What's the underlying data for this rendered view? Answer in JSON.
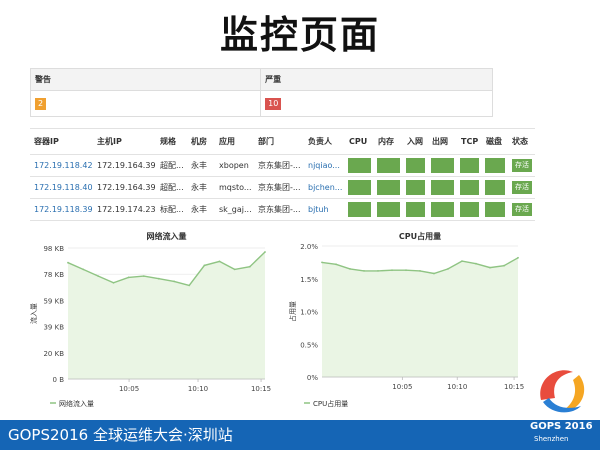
{
  "page": {
    "title": "监控页面"
  },
  "alerts": {
    "headers": [
      "警告",
      "严重"
    ],
    "warning_count": "2",
    "critical_count": "10",
    "warning_color": "#f0a030",
    "critical_color": "#d9534f"
  },
  "containers": {
    "headers": [
      "容器IP",
      "主机IP",
      "规格",
      "机房",
      "应用",
      "部门",
      "负责人",
      "CPU",
      "内存",
      "入网",
      "出网",
      "TCP",
      "磁盘",
      "状态"
    ],
    "rows": [
      {
        "container_ip": "172.19.118.42",
        "host_ip": "172.19.164.39",
        "spec": "超配...",
        "room": "永丰",
        "app": "xbopen",
        "dept": "京东集团-...",
        "owner": "njqiao...",
        "status": "存活"
      },
      {
        "container_ip": "172.19.118.40",
        "host_ip": "172.19.164.39",
        "spec": "超配...",
        "room": "永丰",
        "app": "mqsto...",
        "dept": "京东集团-...",
        "owner": "bjchen...",
        "status": "存活"
      },
      {
        "container_ip": "172.19.118.39",
        "host_ip": "172.19.174.23",
        "spec": "标配...",
        "room": "永丰",
        "app": "sk_gaj...",
        "dept": "京东集团-...",
        "owner": "bjtuh",
        "status": "存活"
      }
    ],
    "metric_color": "#6aa84f"
  },
  "chart_data": [
    {
      "type": "area",
      "title": "网络流入量",
      "ylabel": "流入量",
      "ylim": [
        0,
        98
      ],
      "yticks": [
        "0 B",
        "20 KB",
        "39 KB",
        "59 KB",
        "78 KB",
        "98 KB"
      ],
      "xticks": [
        "10:05",
        "10:10",
        "10:15"
      ],
      "x": [
        0,
        1,
        2,
        3,
        4,
        5,
        6,
        7,
        8,
        9,
        10,
        11,
        12,
        13
      ],
      "series": [
        {
          "name": "网络流入量",
          "values": [
            87,
            82,
            77,
            72,
            76,
            77,
            75,
            73,
            70,
            85,
            88,
            82,
            84,
            95
          ]
        }
      ],
      "legend": "bottom-left"
    },
    {
      "type": "area",
      "title": "CPU占用量",
      "ylabel": "占用量",
      "ylim": [
        0,
        2.0
      ],
      "yticks": [
        "0%",
        "0.5%",
        "1.0%",
        "1.5%",
        "2.0%"
      ],
      "xticks": [
        "10:05",
        "10:10",
        "10:15"
      ],
      "x": [
        0,
        1,
        2,
        3,
        4,
        5,
        6,
        7,
        8,
        9,
        10,
        11,
        12,
        13
      ],
      "series": [
        {
          "name": "CPU占用量",
          "values": [
            1.75,
            1.72,
            1.65,
            1.62,
            1.62,
            1.63,
            1.63,
            1.62,
            1.58,
            1.65,
            1.77,
            1.73,
            1.67,
            1.7,
            1.82
          ]
        }
      ],
      "legend": "bottom-left"
    }
  ],
  "footer": {
    "text": "GOPS2016 全球运维大会·深圳站",
    "logo_title": "GOPS 2016",
    "logo_city": "Shenzhen"
  }
}
